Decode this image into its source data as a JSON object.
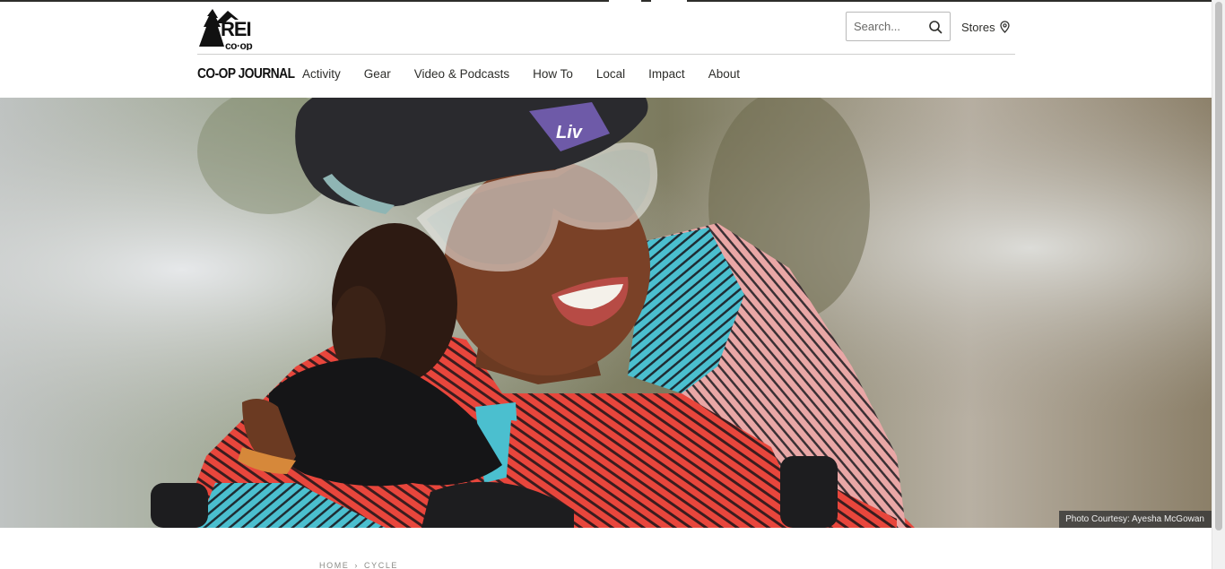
{
  "brand": {
    "logo_text": "REI co-op",
    "journal_label": "CO-OP JOURNAL"
  },
  "header": {
    "search": {
      "placeholder": "Search...",
      "value": ""
    },
    "stores_label": "Stores"
  },
  "nav": {
    "items": [
      {
        "label": "Activity"
      },
      {
        "label": "Gear"
      },
      {
        "label": "Video & Podcasts"
      },
      {
        "label": "How To"
      },
      {
        "label": "Local"
      },
      {
        "label": "Impact"
      },
      {
        "label": "About"
      }
    ]
  },
  "hero": {
    "photo_credit": "Photo Courtesy: Ayesha McGowan",
    "helmet_brand": "Liv"
  },
  "breadcrumb": {
    "items": [
      "HOME",
      "CYCLE"
    ],
    "separator": "›"
  },
  "colors": {
    "text": "#2e2e2b",
    "jersey_red": "#e8463c",
    "jersey_teal": "#4bbfcf",
    "helmet": "#2a2a2e"
  }
}
